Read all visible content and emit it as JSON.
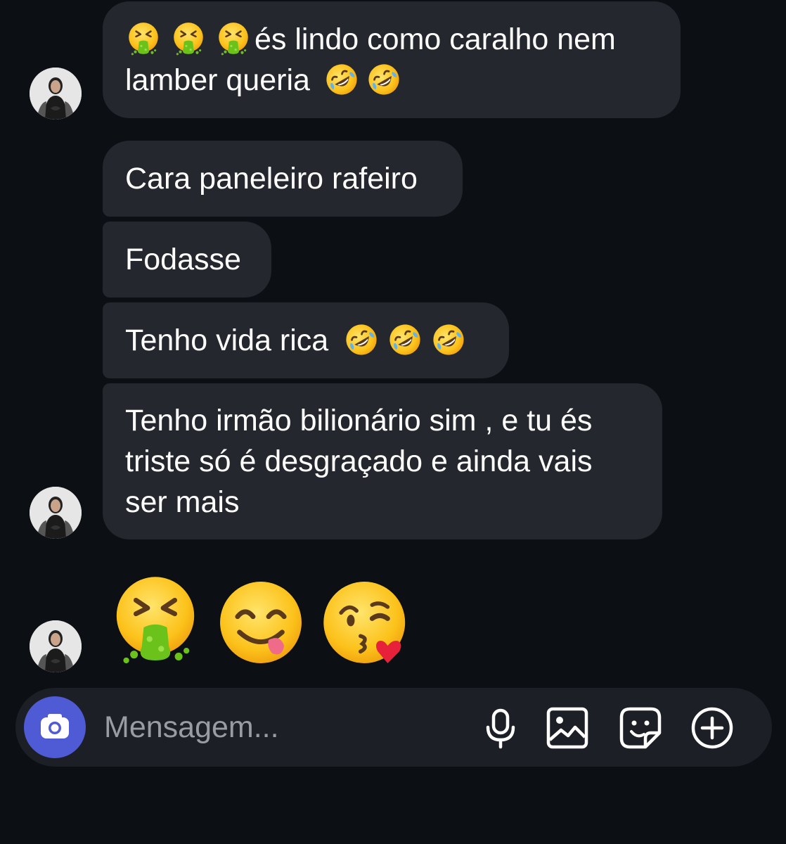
{
  "messages": [
    {
      "text_lines": [
        "és lindo como caralho nem",
        "lamber queria"
      ],
      "leading_emojis": [
        "nauseated-face-emoji",
        "nauseated-face-emoji",
        "nauseated-face-emoji"
      ],
      "trailing_emojis": [
        "rofl-emoji",
        "rofl-emoji"
      ]
    },
    {
      "text": "Cara paneleiro rafeiro"
    },
    {
      "text": "Fodasse"
    },
    {
      "text": "Tenho vida rica",
      "trailing_emojis": [
        "rofl-emoji",
        "rofl-emoji",
        "rofl-emoji"
      ]
    },
    {
      "text_lines": [
        "Tenho irmão bilionário sim , e tu és",
        "triste só é desgraçado e ainda vais",
        "ser mais"
      ]
    }
  ],
  "big_emojis": [
    "nauseated-face-emoji",
    "yum-face-emoji",
    "kissing-heart-wink-emoji"
  ],
  "composer": {
    "placeholder": "Mensagem...",
    "icons": [
      "camera-icon",
      "microphone-icon",
      "gallery-icon",
      "sticker-icon",
      "plus-circle-icon"
    ]
  },
  "colors": {
    "background": "#0c0f14",
    "bubble": "#24272d",
    "composer": "#1c1f26",
    "camera_button": "#4f5bd5",
    "text": "#ffffff",
    "placeholder": "#9a9ca3"
  }
}
